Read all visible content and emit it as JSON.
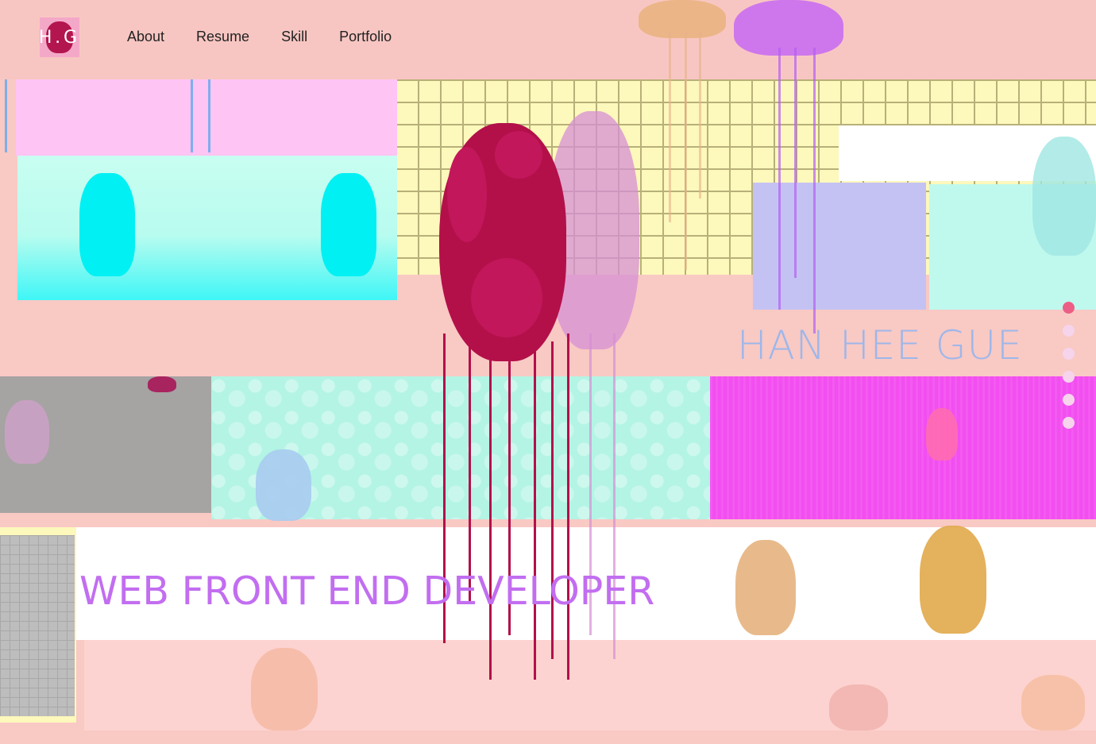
{
  "header": {
    "logo_text": "H.G",
    "nav": [
      {
        "label": "About"
      },
      {
        "label": "Resume"
      },
      {
        "label": "Skill"
      },
      {
        "label": "Portfolio"
      }
    ]
  },
  "hero": {
    "name": "HAN HEE GUE",
    "role": "WEB FRONT END DEVELOPER"
  },
  "pagination": {
    "count": 6,
    "active_index": 0
  },
  "colors": {
    "background": "#f9c9c4",
    "accent_dot": "#ec5e86",
    "name_text": "#9db7ea",
    "role_text": "#c26ef0",
    "heart": "#b3104a"
  },
  "icons": {
    "logo": "crocheted-heart-icon",
    "hero_image": "crocheted-heart-image"
  }
}
